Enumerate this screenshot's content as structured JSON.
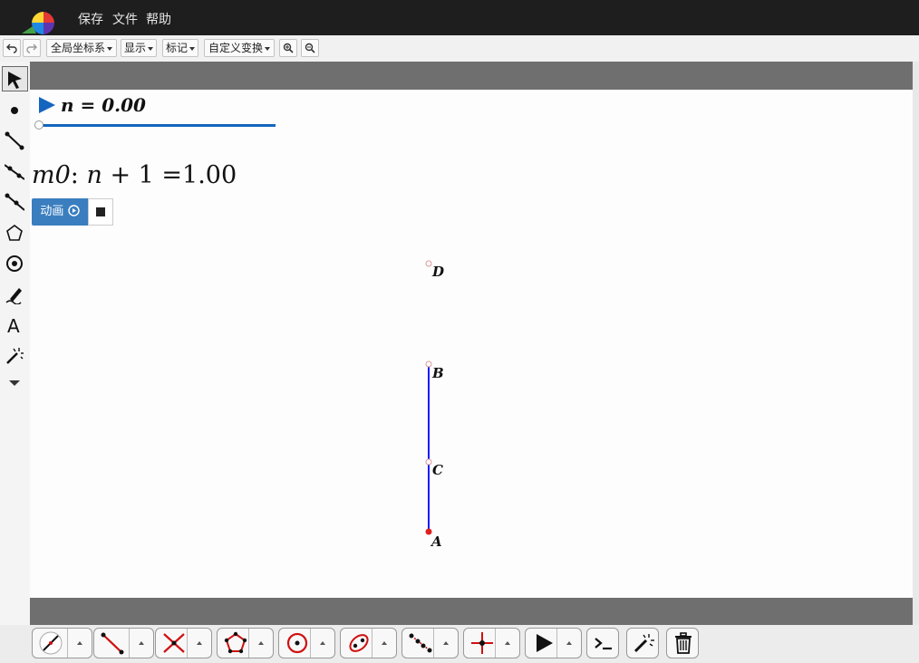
{
  "menu": {
    "save": "保存",
    "file": "文件",
    "help": "帮助"
  },
  "toolbar": {
    "undo_icon": "undo-icon",
    "redo_icon": "redo-icon",
    "coord_system": "全局坐标系",
    "display": "显示",
    "mark": "标记",
    "custom_transform": "自定义变换",
    "zoom_in_icon": "zoom-in-icon",
    "zoom_out_icon": "zoom-out-icon"
  },
  "left_tools": [
    "pointer-icon",
    "point-icon",
    "segment-icon",
    "line-icon",
    "ray-icon",
    "polygon-icon",
    "circle-icon",
    "pen-icon",
    "text-icon",
    "magic-icon",
    "more-icon"
  ],
  "slider": {
    "label": "n = 0.00",
    "value": 0.0
  },
  "measure": {
    "name": "m0",
    "expr_var": "n",
    "expr_rest": "+ 1 =",
    "value": "1.00"
  },
  "animation": {
    "button_label": "动画",
    "stop_icon": "stop-icon"
  },
  "points": {
    "A": "A",
    "B": "B",
    "C": "C",
    "D": "D"
  },
  "colors": {
    "segment": "#1a1aff",
    "point_A": "#e02020",
    "accent": "#3a7ebf",
    "slider": "#1565c0"
  },
  "bottom_tools": [
    "segment-tool-icon",
    "line-tool-icon",
    "intersect-icon",
    "polygon-tool-icon",
    "circle-tool-icon",
    "conic-icon",
    "points-icon",
    "transform-icon",
    "play-icon",
    "terminal-icon",
    "magic-wand-icon",
    "trash-icon"
  ]
}
